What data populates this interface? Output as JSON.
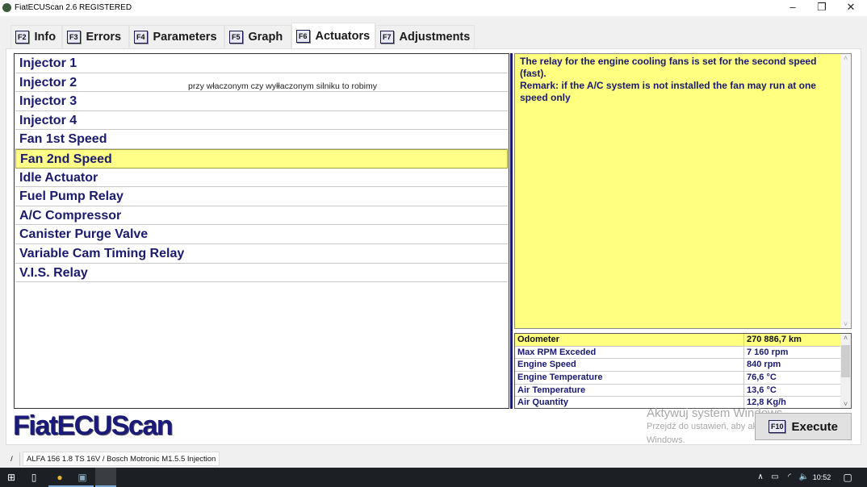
{
  "window": {
    "title": "FiatECUScan 2.6 REGISTERED",
    "minimize": "–",
    "restore": "❐",
    "close": "✕"
  },
  "tabs": [
    {
      "key": "F2",
      "label": "Info"
    },
    {
      "key": "F3",
      "label": "Errors"
    },
    {
      "key": "F4",
      "label": "Parameters"
    },
    {
      "key": "F5",
      "label": "Graph"
    },
    {
      "key": "F6",
      "label": "Actuators"
    },
    {
      "key": "F7",
      "label": "Adjustments"
    }
  ],
  "actuators": [
    "Injector 1",
    "Injector 2",
    "Injector 3",
    "Injector 4",
    "Fan 1st Speed",
    "Fan 2nd Speed",
    "Idle Actuator",
    "Fuel Pump Relay",
    "A/C Compressor",
    "Canister Purge Valve",
    "Variable Cam Timing Relay",
    "V.I.S. Relay"
  ],
  "selected_actuator": "Fan 2nd Speed",
  "note": "przy właczonym czy wyłłaczonym silniku to robimy",
  "description": {
    "line1": "The relay for the engine cooling fans is set for the second speed (fast).",
    "line2": "Remark: if the A/C system is not installed the fan may run at one speed only"
  },
  "params": [
    {
      "name": "Odometer",
      "value": "270 886,7 km"
    },
    {
      "name": "Max RPM Exceded",
      "value": "7 160 rpm"
    },
    {
      "name": "Engine Speed",
      "value": "840 rpm"
    },
    {
      "name": "Engine Temperature",
      "value": "76,6 °C"
    },
    {
      "name": "Air Temperature",
      "value": "13,6 °C"
    },
    {
      "name": "Air Quantity",
      "value": "12,8 Kg/h"
    }
  ],
  "logo": "FiatECUScan",
  "watermark": {
    "line1": "Aktywuj system Windows",
    "line2": "Przejdź do ustawień, aby aktywować",
    "line3": "Windows."
  },
  "execute": {
    "key": "F10",
    "label": "Execute"
  },
  "status": {
    "cell1": "/",
    "vehicle": "ALFA 156 1.8 TS 16V / Bosch Motronic M1.5.5 Injection"
  },
  "taskbar": {
    "time": "10:52"
  },
  "colors": {
    "accent": "#1a1a6e",
    "highlight": "#ffff80"
  }
}
